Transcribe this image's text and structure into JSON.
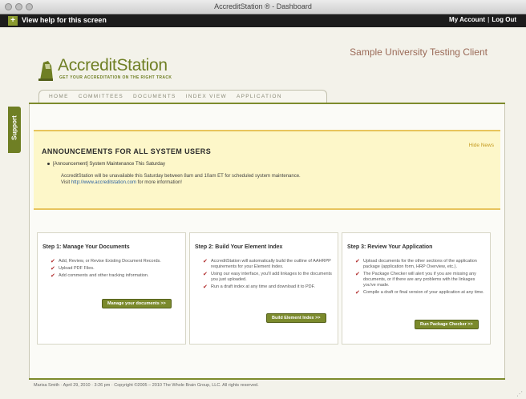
{
  "window": {
    "title": "AccreditStation ® - Dashboard"
  },
  "helpbar": {
    "label": "View help for this screen",
    "plus": "+"
  },
  "topright": {
    "account": "My Account",
    "sep": "|",
    "logout": "Log Out"
  },
  "support": {
    "label": "Support"
  },
  "header": {
    "logo_name": "AccreditStation",
    "tagline": "GET YOUR ACCREDITATION ON THE RIGHT TRACK",
    "client": "Sample University Testing Client"
  },
  "tabs": [
    "HOME",
    "COMMITTEES",
    "DOCUMENTS",
    "INDEX VIEW",
    "APPLICATION"
  ],
  "announcements": {
    "hide": "Hide News",
    "title": "ANNOUNCEMENTS FOR ALL SYSTEM USERS",
    "bullet": "[Announcement] System Maintenance This Saturday",
    "body_1": "AccreditStation will be unavailable this Saturday between 8am and 10am ET for scheduled system maintenance.",
    "body_2_prefix": "Visit",
    "body_2_link": "http://www.accreditstation.com",
    "body_2_suffix": "for more information!"
  },
  "steps": [
    {
      "title": "Step 1: Manage Your Documents",
      "items": [
        "Add, Review, or Revise Existing Document Records.",
        "Upload PDF Files.",
        "Add comments and other tracking information."
      ],
      "button": "Manage your documents >>"
    },
    {
      "title": "Step 2: Build Your Element Index",
      "items": [
        "AccreditStation will automatically build the outline of AAHRPP requirements for your Element Index.",
        "Using our easy interface, you'll add linkages to the documents you just uploaded.",
        "Run a draft index at any time and download it to PDF."
      ],
      "button": "Build Element Index >>"
    },
    {
      "title": "Step 3: Review Your Application",
      "items": [
        "Upload documents for the other sections of the application package (application form, HRP Overview, etc.).",
        "The Package Checker will alert you if you are missing any documents, or if there are any problems with the linkages you've made.",
        "Compile a draft or final version of your application at any time."
      ],
      "button": "Run Package Checker >>"
    }
  ],
  "footer": {
    "text": "Marisa Smith · April 29, 2010 · 3:26 pm · Copyright ©2005 – 2010 The Whole Brain Group, LLC. All rights reserved."
  },
  "colors": {
    "accent": "#6f7f24",
    "news_bg": "#fdf7c9",
    "news_border": "#e7c45d",
    "client": "#9a6a57"
  }
}
